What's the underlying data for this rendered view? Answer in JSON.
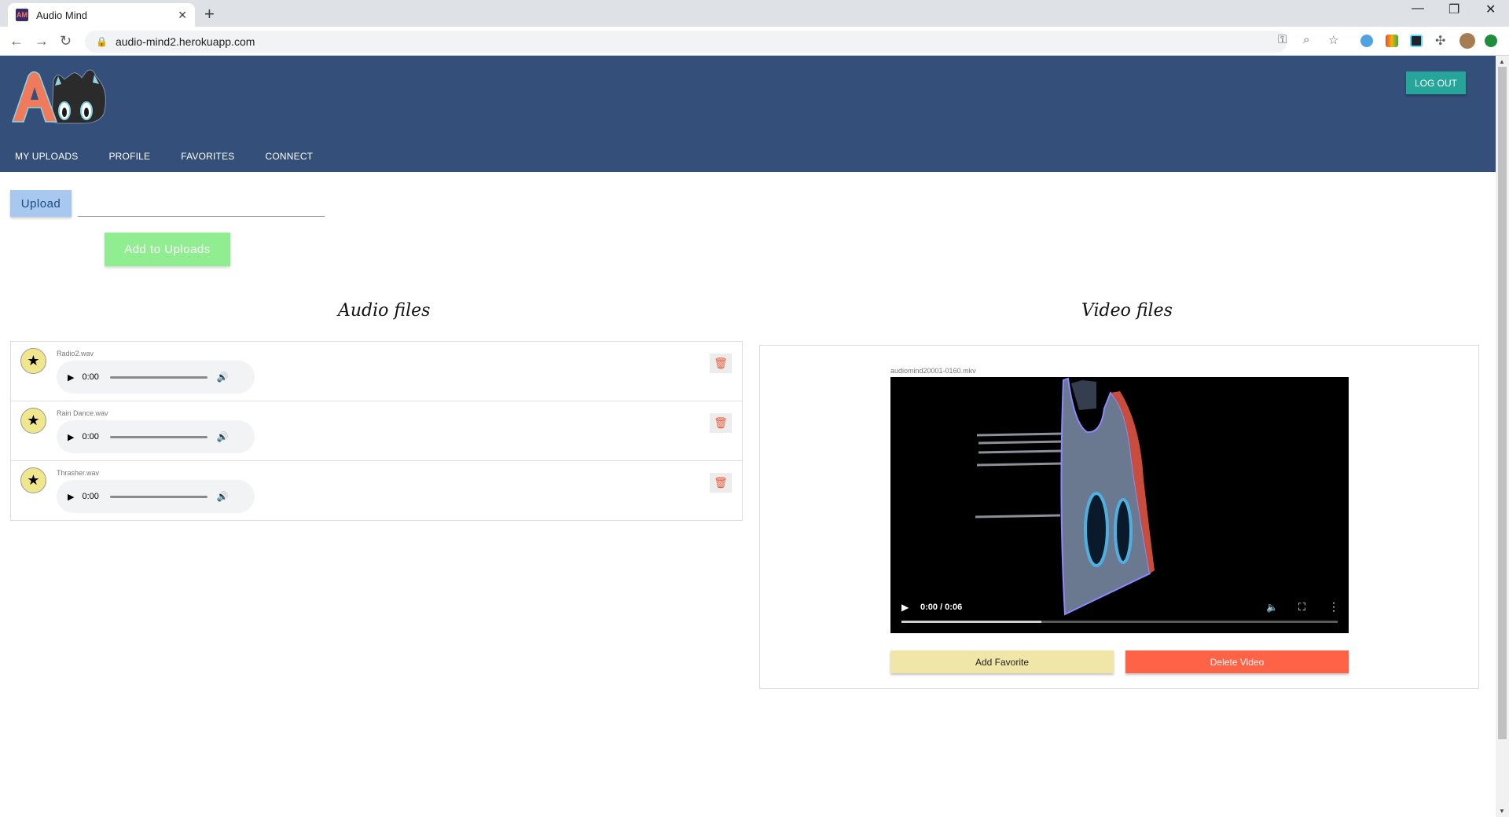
{
  "browser": {
    "tab_title": "Audio Mind",
    "tab_close": "✕",
    "new_tab": "+",
    "url": "audio-mind2.herokuapp.com",
    "window_controls": [
      "—",
      "❐",
      "✕"
    ]
  },
  "header": {
    "logout_label": "LOG OUT",
    "nav": [
      "MY UPLOADS",
      "PROFILE",
      "FAVORITES",
      "CONNECT"
    ]
  },
  "upload": {
    "upload_label": "Upload",
    "add_label": "Add to Uploads"
  },
  "audio": {
    "title": "Audio files",
    "files": [
      {
        "name": "Radio2.wav",
        "time": "0:00"
      },
      {
        "name": "Rain Dance.wav",
        "time": "0:00"
      },
      {
        "name": "Thrasher.wav",
        "time": "0:00"
      }
    ]
  },
  "video": {
    "title": "Video files",
    "file_name": "audiomind20001-0160.mkv",
    "time": "0:00 / 0:06",
    "buffered_fraction": 0.32,
    "add_favorite_label": "Add Favorite",
    "delete_label": "Delete Video"
  },
  "colors": {
    "header": "#34507a",
    "logout": "#26a69a",
    "upload": "#a8c8f0",
    "add_uploads": "#90ee90",
    "favorite_star": "#f0e68c",
    "delete": "#ff6347"
  }
}
